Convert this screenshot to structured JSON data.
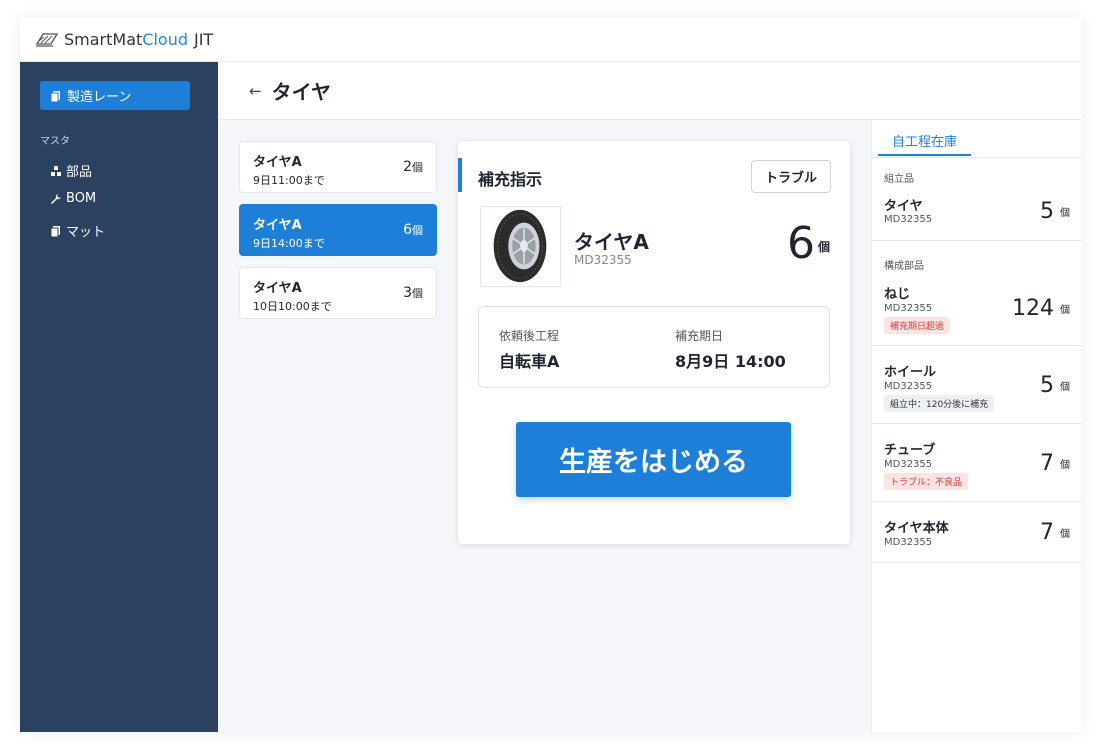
{
  "app": {
    "brand_main": "SmartMat",
    "brand_cloud": "Cloud",
    "brand_suffix": "JIT"
  },
  "sidebar": {
    "active_item": "製造レーン",
    "section_label": "マスタ",
    "items": [
      {
        "label": "部品",
        "icon": "parts-icon"
      },
      {
        "label": "BOM",
        "icon": "wrench-icon"
      },
      {
        "label": "マット",
        "icon": "copy-icon"
      }
    ]
  },
  "header": {
    "back_icon": "←",
    "title": "タイヤ"
  },
  "lanes": [
    {
      "name": "タイヤA",
      "due": "9日11:00まで",
      "qty": "2",
      "unit": "個"
    },
    {
      "name": "タイヤA",
      "due": "9日14:00まで",
      "qty": "6",
      "unit": "個"
    },
    {
      "name": "タイヤA",
      "due": "10日10:00まで",
      "qty": "3",
      "unit": "個"
    }
  ],
  "detail": {
    "title": "補充指示",
    "trouble_label": "トラブル",
    "product_name": "タイヤA",
    "product_code": "MD32355",
    "qty": "6",
    "unit": "個",
    "after_process_label": "依頼後工程",
    "after_process_value": "自転車A",
    "deadline_label": "補充期日",
    "deadline_value": "8月9日 14:00",
    "start_label": "生産をはじめる"
  },
  "inventory": {
    "tab_label": "自工程在庫",
    "section_assembled": "組立品",
    "section_components": "構成部品",
    "items": [
      {
        "name": "タイヤ",
        "code": "MD32355",
        "qty": "5",
        "unit": "個",
        "badge": ""
      },
      {
        "name": "ねじ",
        "code": "MD32355",
        "qty": "124",
        "unit": "個",
        "badge": "補充期日超過"
      },
      {
        "name": "ホイール",
        "code": "MD32355",
        "qty": "5",
        "unit": "個",
        "badge": "組立中：120分後に補充"
      },
      {
        "name": "チューブ",
        "code": "MD32355",
        "qty": "7",
        "unit": "個",
        "badge": "トラブル：不良品"
      },
      {
        "name": "タイヤ本体",
        "code": "MD32355",
        "qty": "7",
        "unit": "個",
        "badge": ""
      }
    ]
  },
  "colors": {
    "accent": "#1e7fd8",
    "sidebar": "#2b4160",
    "alert_bg": "#fde3e3",
    "alert_text": "#d83b3b"
  }
}
